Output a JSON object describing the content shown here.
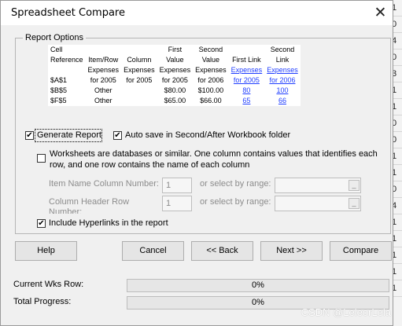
{
  "window": {
    "title": "Spreadsheet Compare",
    "close_glyph": "✕"
  },
  "background_cells": [
    "1",
    "0",
    "4",
    "0",
    "3",
    "1",
    "1",
    "0",
    "0",
    "1",
    "1",
    "0",
    "4",
    "1",
    "1",
    "1",
    "1",
    "1"
  ],
  "report_options": {
    "legend": "Report Options",
    "preview_table": {
      "header_row_1": [
        "Cell",
        "",
        "",
        "First",
        "Second",
        "",
        "Second"
      ],
      "header_row_2": [
        "Reference",
        "Item/Row",
        "Column",
        "Value",
        "Value",
        "First Link",
        "Link"
      ],
      "rows": [
        [
          "",
          "Expenses",
          "Expenses",
          "Expenses",
          "Expenses",
          "Expenses",
          "Expenses"
        ],
        [
          "$A$1",
          "for 2005",
          "for 2005",
          "for 2005",
          "for 2006",
          "for 2005",
          "for 2006"
        ],
        [
          "$B$5",
          "Other",
          "",
          "$80.00",
          "$100.00",
          "80",
          "100"
        ],
        [
          "$F$5",
          "Other",
          "",
          "$65.00",
          "$66.00",
          "65",
          "66"
        ]
      ]
    },
    "generate_report": {
      "label": "Generate Report",
      "checked": true
    },
    "auto_save": {
      "label": "Auto save in Second/After Workbook folder",
      "checked": true
    },
    "worksheets_db": {
      "label_line1": "Worksheets are databases or similar. One column contains values that identifies each",
      "label_line2": "row, and one row contains the name of each column",
      "checked": false
    },
    "item_name_column": {
      "label": "Item Name Column Number:",
      "value": "1",
      "range_label": "or select by range:"
    },
    "column_header_row": {
      "label_line1": "Column Header Row",
      "label_line2": "Number:",
      "value": "1",
      "range_label": "or select by range:"
    },
    "include_hyperlinks": {
      "label": "Include Hyperlinks in the report",
      "checked": true
    }
  },
  "buttons": {
    "help": "Help",
    "cancel": "Cancel",
    "back": "<< Back",
    "next": "Next >>",
    "compare": "Compare"
  },
  "progress": {
    "current_label": "Current Wks Row:",
    "current_value": "0%",
    "current_fraction": 0,
    "total_label": "Total Progress:",
    "total_value": "0%",
    "total_fraction": 0
  },
  "watermark": "CSDN @LeleorLela",
  "colors": {
    "link": "#1f3dff",
    "dialog_bg": "#f0f0f0",
    "button_bg": "#e5e5e5"
  }
}
